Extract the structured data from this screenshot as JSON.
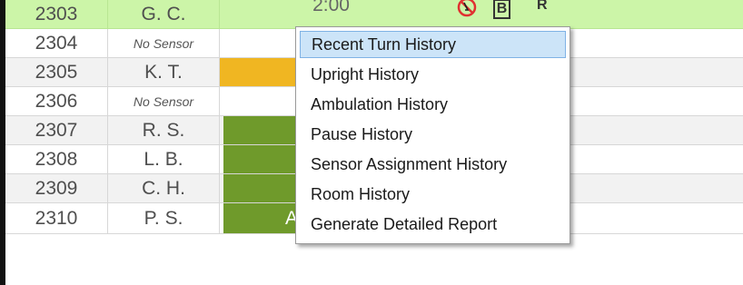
{
  "top_heading_partial": "",
  "rows": [
    {
      "room": "2303",
      "patient": "G. C.",
      "status": "",
      "time": "2:00",
      "icon_b": "B",
      "icon_r": "R"
    },
    {
      "room": "2304",
      "patient": "No Sensor",
      "status": ""
    },
    {
      "room": "2305",
      "patient": "K. T.",
      "status": ""
    },
    {
      "room": "2306",
      "patient": "No Sensor",
      "status": ""
    },
    {
      "room": "2307",
      "patient": "R. S.",
      "status": ""
    },
    {
      "room": "2308",
      "patient": "L. B.",
      "status": ""
    },
    {
      "room": "2309",
      "patient": "C. H.",
      "status": ""
    },
    {
      "room": "2310",
      "patient": "P. S.",
      "status": "Ambulating"
    }
  ],
  "context_menu": {
    "items": [
      "Recent Turn History",
      "Upright History",
      "Ambulation History",
      "Pause History",
      "Sensor Assignment History",
      "Room History",
      "Generate Detailed Report"
    ],
    "selected_index": 0
  },
  "colors": {
    "highlight_row": "#ccf5a8",
    "amber_status": "#f0b622",
    "green_status": "#6f9a2b",
    "selection": "#cce4f8"
  },
  "icons": {
    "top_row": [
      "no-turn-circle-icon",
      "b-box-icon",
      "r-letter-icon"
    ],
    "bottom_row": [
      "walking-person-icon",
      "walking-person-icon",
      "walking-person-icon"
    ]
  }
}
